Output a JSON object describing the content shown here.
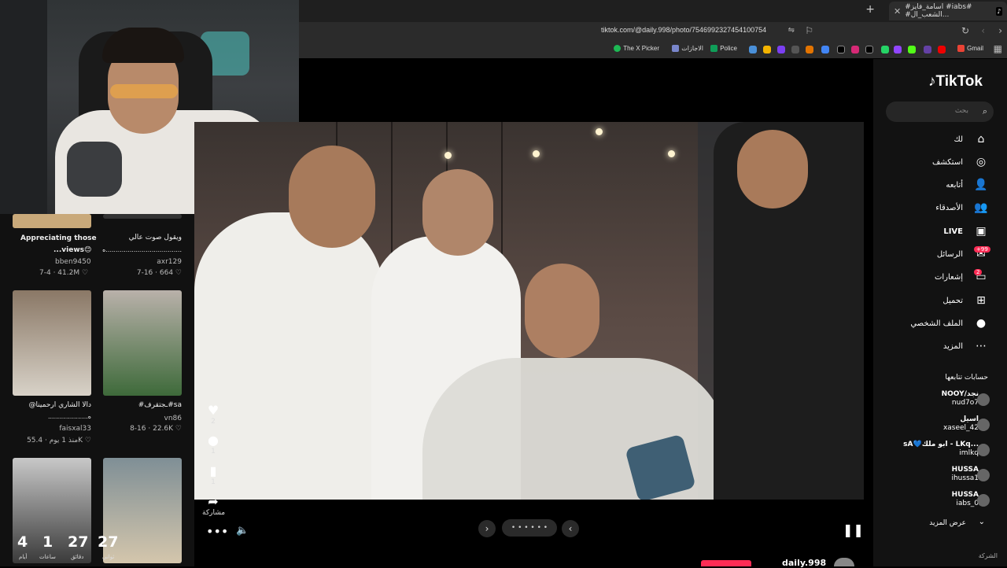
{
  "browser": {
    "tab_title": "#اسامة_فايز #iabs# #الشعب_ال...",
    "url": "tiktok.com/@daily.998/photo/7546992327454100754",
    "bookmarks": [
      "Gmail",
      "The X Picker",
      "الاجازات",
      "Police"
    ]
  },
  "left_grid": {
    "cards": [
      {
        "title": "Appreciating those",
        "title2": "...views😊",
        "user": "bben9450",
        "date": "7-4",
        "likes": "41.2M"
      },
      {
        "title": "ويقول صوت عالي",
        "title2": "ه......................................",
        "user": "axr129",
        "date": "7-16",
        "likes": "664"
      },
      {
        "title": "@دالا الشاري ارحمينا",
        "title2": "....................ه",
        "user": "faisxal33",
        "date": "منذ 1 يوم",
        "likes": "55.4K"
      },
      {
        "title": "#ـجتقرف#sa",
        "title2": "",
        "user": "vn86",
        "date": "8-16",
        "likes": "22.6K"
      }
    ],
    "countdown": [
      {
        "value": "27",
        "label": "ثواني"
      },
      {
        "value": "27",
        "label": "دقائق"
      },
      {
        "value": "1",
        "label": "ساعات"
      },
      {
        "value": "4",
        "label": "أيام"
      }
    ]
  },
  "actions": [
    {
      "icon": "heart-icon",
      "count": "2"
    },
    {
      "icon": "comment-icon",
      "count": "1"
    },
    {
      "icon": "bookmark-icon",
      "count": "1"
    },
    {
      "icon": "share-icon",
      "count": "مشاركة"
    }
  ],
  "player": {
    "page_dots": "• • • • • •",
    "next_symbol": "‹",
    "prev_symbol": "›",
    "author": "daily.998"
  },
  "sidebar": {
    "logo": "TikTok",
    "search_placeholder": "بحث",
    "nav": [
      {
        "label": "لك",
        "icon": "home-icon"
      },
      {
        "label": "استكشف",
        "icon": "explore-icon"
      },
      {
        "label": "أتابعه",
        "icon": "following-icon"
      },
      {
        "label": "الأصدقاء",
        "icon": "friends-icon"
      },
      {
        "label": "LIVE",
        "icon": "live-icon"
      },
      {
        "label": "الرسائل",
        "icon": "messages-icon",
        "badge": "+99"
      },
      {
        "label": "إشعارات",
        "icon": "notifications-icon",
        "badge": "2"
      },
      {
        "label": "تحميل",
        "icon": "upload-icon"
      },
      {
        "label": "الملف الشخصي",
        "icon": "profile-icon"
      },
      {
        "label": "المزيد",
        "icon": "more-icon"
      }
    ],
    "following_header": "حسابات تتابعها",
    "following": [
      {
        "name": "NOOY/نجد",
        "handle": "nud7o7"
      },
      {
        "name": "اسيل",
        "handle": "xaseel_42"
      },
      {
        "name": "sA💙ابو ملك - LKq...",
        "handle": "imlkq"
      },
      {
        "name": "HUSSA",
        "handle": "ihussa1"
      },
      {
        "name": "HUSSA",
        "handle": "iabs_0"
      }
    ],
    "see_more": "عرض المزيد",
    "footer": "الشركة"
  },
  "colors": {
    "accent": "#fe2c55",
    "bg": "#000000",
    "sidebar": "#121212"
  }
}
